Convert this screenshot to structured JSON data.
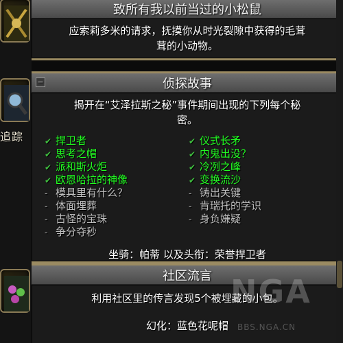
{
  "achievements": [
    {
      "title": "致所有我以前当过的小松鼠",
      "description_lines": [
        "应索莉多米的请求，抚摸你从时光裂隙中获得的毛茸",
        "茸的小动物。"
      ],
      "icon": "crossed-totem-icon"
    },
    {
      "title": "侦探故事",
      "description_lines": [
        "揭开在“艾泽拉斯之秘”事件期间出现的下列每个秘",
        "密。"
      ],
      "icon": "magnifying-glass-icon",
      "criteria": [
        {
          "text": "捍卫者",
          "done": true
        },
        {
          "text": "仪式长矛",
          "done": true
        },
        {
          "text": "思考之帽",
          "done": true
        },
        {
          "text": "内鬼出没？",
          "done": true
        },
        {
          "text": "派和斯火炬",
          "done": true
        },
        {
          "text": "冷冽之峰",
          "done": true
        },
        {
          "text": "欧恩哈拉的神像",
          "done": true
        },
        {
          "text": "变换流沙",
          "done": true
        },
        {
          "text": "模具里有什么？",
          "done": false
        },
        {
          "text": "铸出关键",
          "done": false
        },
        {
          "text": "体面埋葬",
          "done": false
        },
        {
          "text": "肯瑞托的学识",
          "done": false
        },
        {
          "text": "古怪的宝珠",
          "done": false
        },
        {
          "text": "身负嫌疑",
          "done": false
        },
        {
          "text": "争分夺秒",
          "done": false
        }
      ],
      "reward": "坐骑：帕蒂 以及头衔：荣誉捍卫者"
    },
    {
      "title": "社区流言",
      "description": "利用社区里的传言发现5个被埋藏的小包。",
      "icon": "flower-bag-icon",
      "reward": "幻化：蓝色花呢帽"
    }
  ],
  "side_label": "追踪",
  "collapse_symbol": "−",
  "watermark": {
    "logo": "NGA",
    "url": "BBS.NGA.CN"
  },
  "colors": {
    "done": "#22ff22",
    "todo": "#bdbdbd",
    "frame": "#9b8b62"
  }
}
